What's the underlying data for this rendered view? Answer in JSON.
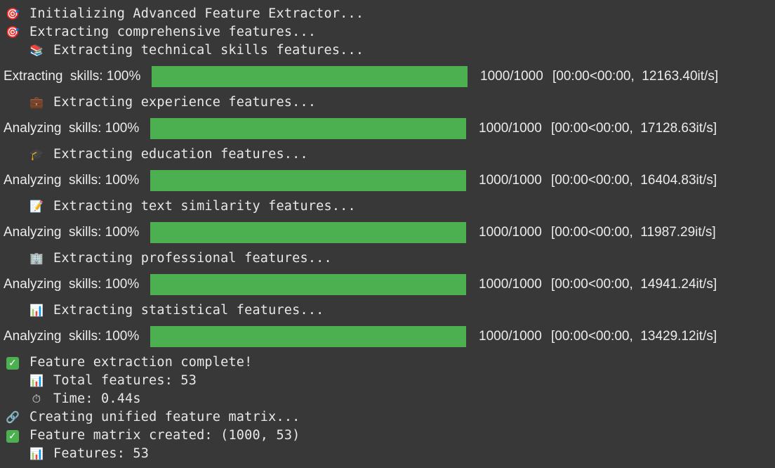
{
  "colors": {
    "background": "#383838",
    "text": "#e8e8e8",
    "bar_fill": "#4caf50"
  },
  "lines": [
    {
      "icon": "target-icon",
      "glyph": "🎯",
      "text": "Initializing Advanced Feature Extractor..."
    },
    {
      "icon": "target-icon",
      "glyph": "🎯",
      "text": "Extracting comprehensive features..."
    },
    {
      "icon": "books-icon",
      "glyph": "📚",
      "text": "Extracting technical skills features..."
    },
    {
      "icon": "briefcase-icon",
      "glyph": "💼",
      "text": "Extracting experience features..."
    },
    {
      "icon": "graduation-cap-icon",
      "glyph": "🎓",
      "text": "Extracting education features..."
    },
    {
      "icon": "memo-icon",
      "glyph": "📝",
      "text": "Extracting text similarity features..."
    },
    {
      "icon": "office-building-icon",
      "glyph": "🏢",
      "text": "Extracting professional features..."
    },
    {
      "icon": "bar-chart-icon",
      "glyph": "📊",
      "text": "Extracting statistical features..."
    },
    {
      "icon": "check-mark-icon",
      "glyph": "✓",
      "text": "Feature extraction complete!"
    },
    {
      "icon": "bar-chart-icon",
      "glyph": "📊",
      "text": "Total features: 53"
    },
    {
      "icon": "stopwatch-icon",
      "glyph": "⏱",
      "text": "Time: 0.44s"
    },
    {
      "icon": "link-icon",
      "glyph": "🔗",
      "text": "Creating unified feature matrix..."
    },
    {
      "icon": "check-mark-icon",
      "glyph": "✓",
      "text": "Feature matrix created: (1000, 53)"
    },
    {
      "icon": "bar-chart-icon",
      "glyph": "📊",
      "text": "Features: 53"
    }
  ],
  "progress": [
    {
      "label": "Extracting  skills: 100%",
      "fraction": 1.0,
      "count": "1000/1000",
      "timing": "[00:00<00:00,  12163.40it/s]"
    },
    {
      "label": "Analyzing  skills: 100%",
      "fraction": 1.0,
      "count": "1000/1000",
      "timing": "[00:00<00:00,  17128.63it/s]"
    },
    {
      "label": "Analyzing  skills: 100%",
      "fraction": 1.0,
      "count": "1000/1000",
      "timing": "[00:00<00:00,  16404.83it/s]"
    },
    {
      "label": "Analyzing  skills: 100%",
      "fraction": 1.0,
      "count": "1000/1000",
      "timing": "[00:00<00:00,  11987.29it/s]"
    },
    {
      "label": "Analyzing  skills: 100%",
      "fraction": 1.0,
      "count": "1000/1000",
      "timing": "[00:00<00:00,  14941.24it/s]"
    },
    {
      "label": "Analyzing  skills: 100%",
      "fraction": 1.0,
      "count": "1000/1000",
      "timing": "[00:00<00:00,  13429.12it/s]"
    }
  ]
}
